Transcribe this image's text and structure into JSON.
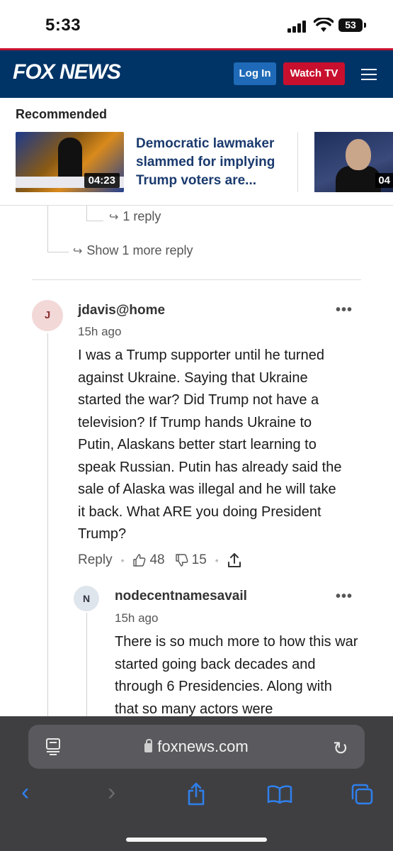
{
  "status_bar": {
    "time": "5:33",
    "battery": "53"
  },
  "header": {
    "logo": "FOX NEWS",
    "login_label": "Log In",
    "watch_label": "Watch TV"
  },
  "recommended": {
    "title": "Recommended",
    "items": [
      {
        "duration": "04:23",
        "headline": "Democratic lawmaker slammed for implying Trump voters are..."
      },
      {
        "duration": "04"
      }
    ]
  },
  "thread_above": {
    "reply_count": "1 reply",
    "show_more": "Show 1 more reply"
  },
  "comment": {
    "avatar": "J",
    "username": "jdavis@home",
    "time": "15h ago",
    "body": "I was a Trump supporter until he turned against Ukraine. Saying that Ukraine started the war? Did Trump not have a television? If Trump hands Ukraine to Putin, Alaskans better start learning to speak Russian. Putin has already said the sale of Alaska was illegal and he will take it back. What ARE you doing President Trump?",
    "reply_label": "Reply",
    "likes": "48",
    "dislikes": "15",
    "more": "•••"
  },
  "reply": {
    "avatar": "N",
    "username": "nodecentnamesavail",
    "time": "15h ago",
    "body": "There is so much more to how this war started going back decades and through 6 Presidencies. Along with that so many actors were",
    "more": "•••"
  },
  "browser": {
    "url": "foxnews.com"
  },
  "colors": {
    "fox_navy": "#003366",
    "fox_red": "#c8102e",
    "login_blue": "#1f6ab8",
    "ios_blue": "#2f80ed"
  }
}
